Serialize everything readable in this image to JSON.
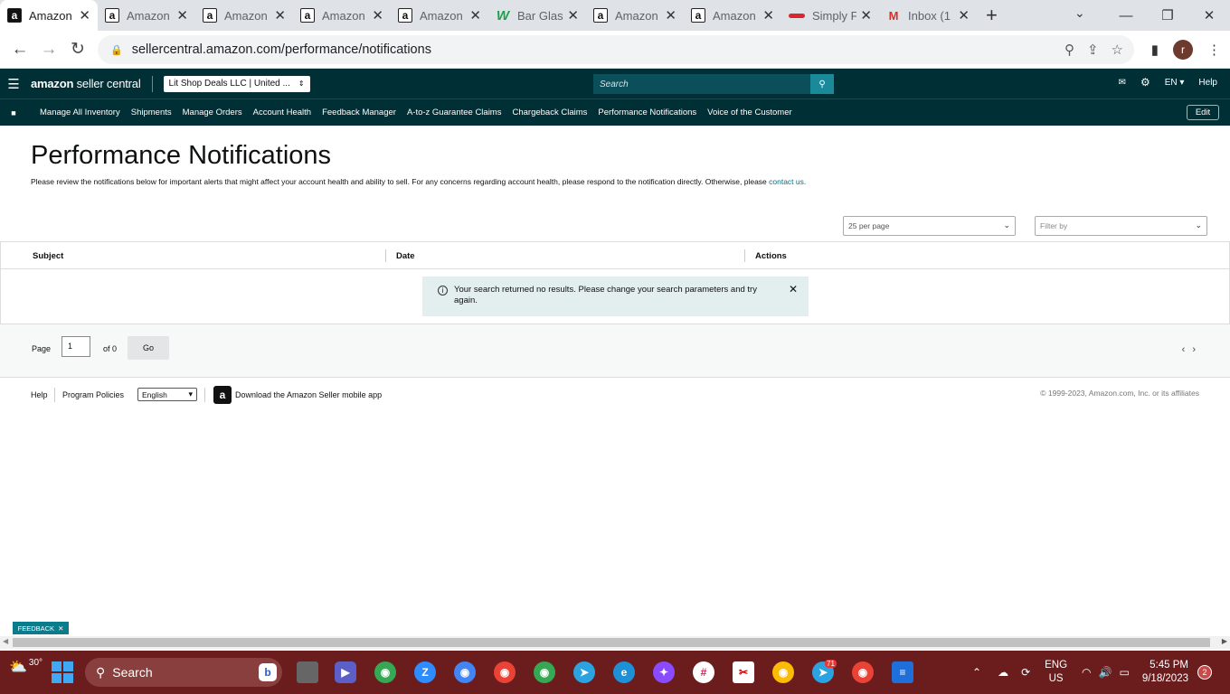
{
  "browser": {
    "tabs": [
      {
        "title": "Amazon",
        "icon": "amazon-icon",
        "active": true
      },
      {
        "title": "Amazon",
        "icon": "amazon-icon"
      },
      {
        "title": "Amazon",
        "icon": "amazon-icon"
      },
      {
        "title": "Amazon",
        "icon": "amazon-icon"
      },
      {
        "title": "Amazon",
        "icon": "amazon-icon"
      },
      {
        "title": "Bar Glas",
        "icon": "w-icon"
      },
      {
        "title": "Amazon",
        "icon": "amazon-icon"
      },
      {
        "title": "Amazon",
        "icon": "amazon-icon"
      },
      {
        "title": "Simply F",
        "icon": "simply-icon"
      },
      {
        "title": "Inbox (1",
        "icon": "gmail-icon"
      }
    ],
    "url": "sellercentral.amazon.com/performance/notifications",
    "profile_initial": "r"
  },
  "header": {
    "logo_bold": "amazon",
    "logo_rest": " seller central",
    "store": "Lit Shop Deals LLC | United ...",
    "search_placeholder": "Search",
    "lang": "EN",
    "help": "Help"
  },
  "nav": {
    "items": [
      "Manage All Inventory",
      "Shipments",
      "Manage Orders",
      "Account Health",
      "Feedback Manager",
      "A-to-z Guarantee Claims",
      "Chargeback Claims",
      "Performance Notifications",
      "Voice of the Customer"
    ],
    "edit": "Edit"
  },
  "page": {
    "title": "Performance Notifications",
    "description": "Please review the notifications below for important alerts that might affect your account health and ability to sell. For any concerns regarding account health, please respond to the notification directly. Otherwise, please ",
    "contact_link": "contact us.",
    "per_page": "25 per page",
    "filter_placeholder": "Filter by",
    "columns": [
      "Subject",
      "Date",
      "Actions"
    ],
    "alert": "Your search returned no results. Please change your search parameters and try again.",
    "pager": {
      "page_label": "Page",
      "page_value": "1",
      "of_label": "of 0",
      "go": "Go"
    }
  },
  "footer": {
    "help": "Help",
    "policies": "Program Policies",
    "language": "English",
    "app": "Download the Amazon Seller mobile app",
    "copyright": "© 1999-2023, Amazon.com, Inc. or its affiliates"
  },
  "feedback": "FEEDBACK",
  "taskbar": {
    "temp": "30°",
    "search": "Search",
    "lang_line1": "ENG",
    "lang_line2": "US",
    "time": "5:45 PM",
    "date": "9/18/2023",
    "notifications": "2",
    "telegram_badge": "71"
  }
}
